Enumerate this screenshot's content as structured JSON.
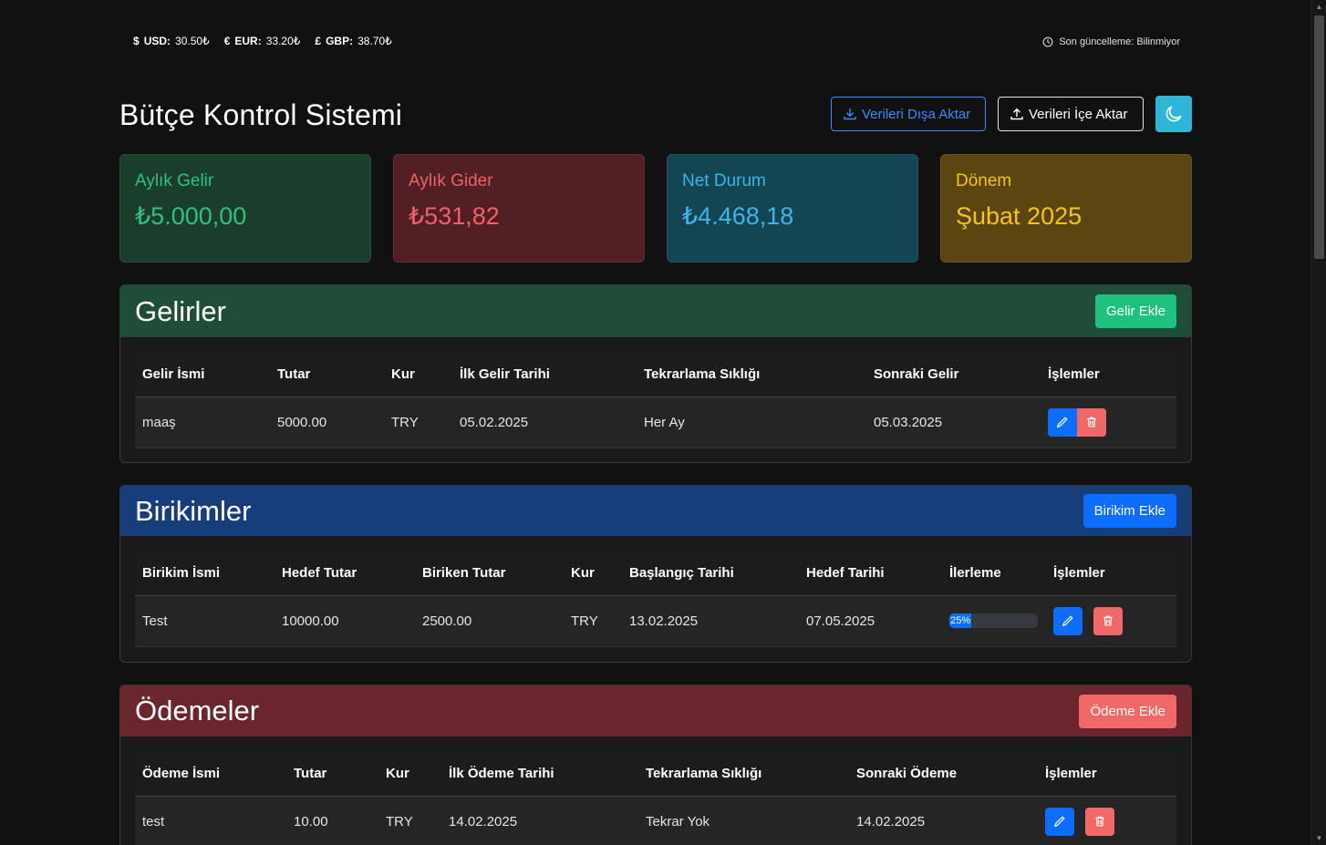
{
  "rates": [
    {
      "symbol": "$",
      "code": "USD:",
      "value": "30.50₺"
    },
    {
      "symbol": "€",
      "code": "EUR:",
      "value": "33.20₺"
    },
    {
      "symbol": "£",
      "code": "GBP:",
      "value": "38.70₺"
    }
  ],
  "last_update": "Son güncelleme: Bilinmiyor",
  "header": {
    "title": "Bütçe Kontrol Sistemi",
    "export_label": "Verileri Dışa Aktar",
    "import_label": "Verileri İçe Aktar",
    "theme_icon": "moon-icon"
  },
  "cards": [
    {
      "label": "Aylık Gelir",
      "value": "₺5.000,00"
    },
    {
      "label": "Aylık Gider",
      "value": "₺531,82"
    },
    {
      "label": "Net Durum",
      "value": "₺4.468,18"
    },
    {
      "label": "Dönem",
      "value": "Şubat 2025"
    }
  ],
  "income": {
    "title": "Gelirler",
    "add_label": "Gelir Ekle",
    "columns": [
      "Gelir İsmi",
      "Tutar",
      "Kur",
      "İlk Gelir Tarihi",
      "Tekrarlama Sıklığı",
      "Sonraki Gelir",
      "İşlemler"
    ],
    "rows": [
      {
        "name": "maaş",
        "amount": "5000.00",
        "currency": "TRY",
        "first_date": "05.02.2025",
        "frequency": "Her Ay",
        "next": "05.03.2025"
      }
    ]
  },
  "savings": {
    "title": "Birikimler",
    "add_label": "Birikim Ekle",
    "columns": [
      "Birikim İsmi",
      "Hedef Tutar",
      "Biriken Tutar",
      "Kur",
      "Başlangıç Tarihi",
      "Hedef Tarihi",
      "İlerleme",
      "İşlemler"
    ],
    "rows": [
      {
        "name": "Test",
        "target": "10000.00",
        "saved": "2500.00",
        "currency": "TRY",
        "start": "13.02.2025",
        "end": "07.05.2025",
        "progress_label": "25%",
        "progress": 0.25
      }
    ]
  },
  "payments": {
    "title": "Ödemeler",
    "add_label": "Ödeme Ekle",
    "columns": [
      "Ödeme İsmi",
      "Tutar",
      "Kur",
      "İlk Ödeme Tarihi",
      "Tekrarlama Sıklığı",
      "Sonraki Ödeme",
      "İşlemler"
    ],
    "rows": [
      {
        "name": "test",
        "amount": "10.00",
        "currency": "TRY",
        "first_date": "14.02.2025",
        "frequency": "Tekrar Yok",
        "next": "14.02.2025"
      }
    ]
  },
  "colors": {
    "income_accent": "#2ec27e",
    "expense_accent": "#f0606b",
    "net_accent": "#3db5e8",
    "period_accent": "#f5c518",
    "primary": "#0d6efd",
    "danger": "#f16868"
  }
}
